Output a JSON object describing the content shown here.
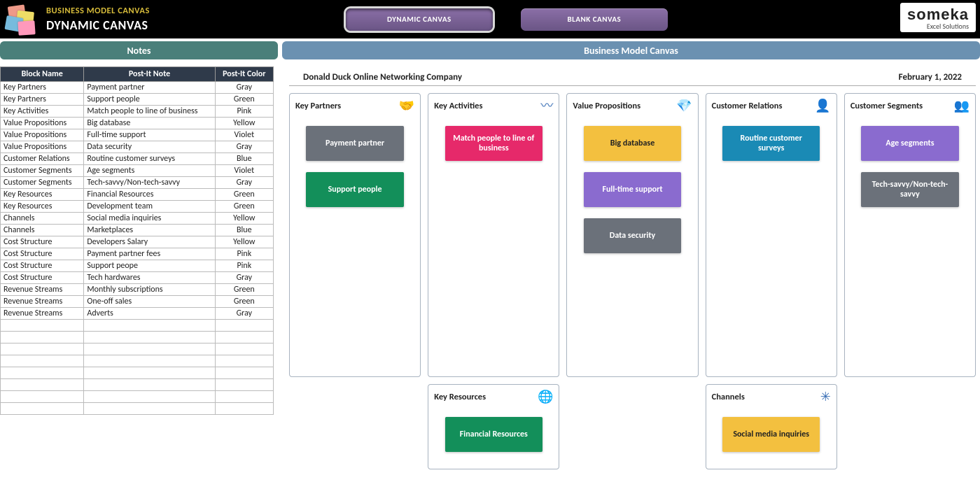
{
  "header": {
    "app_title": "BUSINESS MODEL CANVAS",
    "page_title": "DYNAMIC CANVAS",
    "tabs": [
      {
        "label": "DYNAMIC CANVAS",
        "active": true
      },
      {
        "label": "BLANK CANVAS",
        "active": false
      }
    ],
    "brand": {
      "name": "someka",
      "sub": "Excel Solutions"
    }
  },
  "sections": {
    "notes_label": "Notes",
    "canvas_label": "Business Model Canvas"
  },
  "notes_table": {
    "columns": [
      "Block Name",
      "Post-It Note",
      "Post-It Color"
    ],
    "rows": [
      [
        "Key Partners",
        "Payment partner",
        "Gray"
      ],
      [
        "Key Partners",
        "Support people",
        "Green"
      ],
      [
        "Key Activities",
        "Match people to line of business",
        "Pink"
      ],
      [
        "Value Propositions",
        "Big database",
        "Yellow"
      ],
      [
        "Value Propositions",
        "Full-time support",
        "Violet"
      ],
      [
        "Value Propositions",
        "Data security",
        "Gray"
      ],
      [
        "Customer Relations",
        "Routine customer surveys",
        "Blue"
      ],
      [
        "Customer Segments",
        "Age segments",
        "Violet"
      ],
      [
        "Customer Segments",
        "Tech-savvy/Non-tech-savvy",
        "Gray"
      ],
      [
        "Key Resources",
        "Financial Resources",
        "Green"
      ],
      [
        "Key Resources",
        "Development team",
        "Green"
      ],
      [
        "Channels",
        "Social media inquiries",
        "Yellow"
      ],
      [
        "Channels",
        "Marketplaces",
        "Blue"
      ],
      [
        "Cost Structure",
        "Developers Salary",
        "Yellow"
      ],
      [
        "Cost Structure",
        "Payment partner fees",
        "Pink"
      ],
      [
        "Cost Structure",
        "Support peope",
        "Pink"
      ],
      [
        "Cost Structure",
        "Tech hardwares",
        "Gray"
      ],
      [
        "Revenue Streams",
        "Monthly subscriptions",
        "Green"
      ],
      [
        "Revenue Streams",
        "One-off sales",
        "Green"
      ],
      [
        "Revenue Streams",
        "Adverts",
        "Gray"
      ]
    ],
    "empty_rows": 8
  },
  "canvas": {
    "company": "Donald Duck Online Networking Company",
    "date": "February 1, 2022",
    "columns": [
      {
        "blocks": [
          {
            "title": "Key Partners",
            "icon": "🤝",
            "tall": true,
            "notes": [
              {
                "text": "Payment partner",
                "color": "gray"
              },
              {
                "text": "Support people",
                "color": "green"
              }
            ]
          }
        ]
      },
      {
        "blocks": [
          {
            "title": "Key Activities",
            "icon": "〰",
            "tall": true,
            "notes": [
              {
                "text": "Match people to line of business",
                "color": "pink"
              }
            ]
          },
          {
            "title": "Key Resources",
            "icon": "🌐",
            "short": true,
            "notes": [
              {
                "text": "Financial Resources",
                "color": "green"
              }
            ]
          }
        ]
      },
      {
        "blocks": [
          {
            "title": "Value Propositions",
            "icon": "💎",
            "tall": true,
            "notes": [
              {
                "text": "Big database",
                "color": "yellow"
              },
              {
                "text": "Full-time support",
                "color": "violet"
              },
              {
                "text": "Data security",
                "color": "gray"
              }
            ]
          }
        ]
      },
      {
        "blocks": [
          {
            "title": "Customer Relations",
            "icon": "👤",
            "tall": true,
            "notes": [
              {
                "text": "Routine customer surveys",
                "color": "blue"
              }
            ]
          },
          {
            "title": "Channels",
            "icon": "✳",
            "short": true,
            "notes": [
              {
                "text": "Social media inquiries",
                "color": "yellow"
              }
            ]
          }
        ]
      },
      {
        "blocks": [
          {
            "title": "Customer Segments",
            "icon": "👥",
            "tall": true,
            "notes": [
              {
                "text": "Age segments",
                "color": "violet"
              },
              {
                "text": "Tech-savvy/Non-tech-savvy",
                "color": "gray"
              }
            ]
          }
        ]
      }
    ]
  }
}
